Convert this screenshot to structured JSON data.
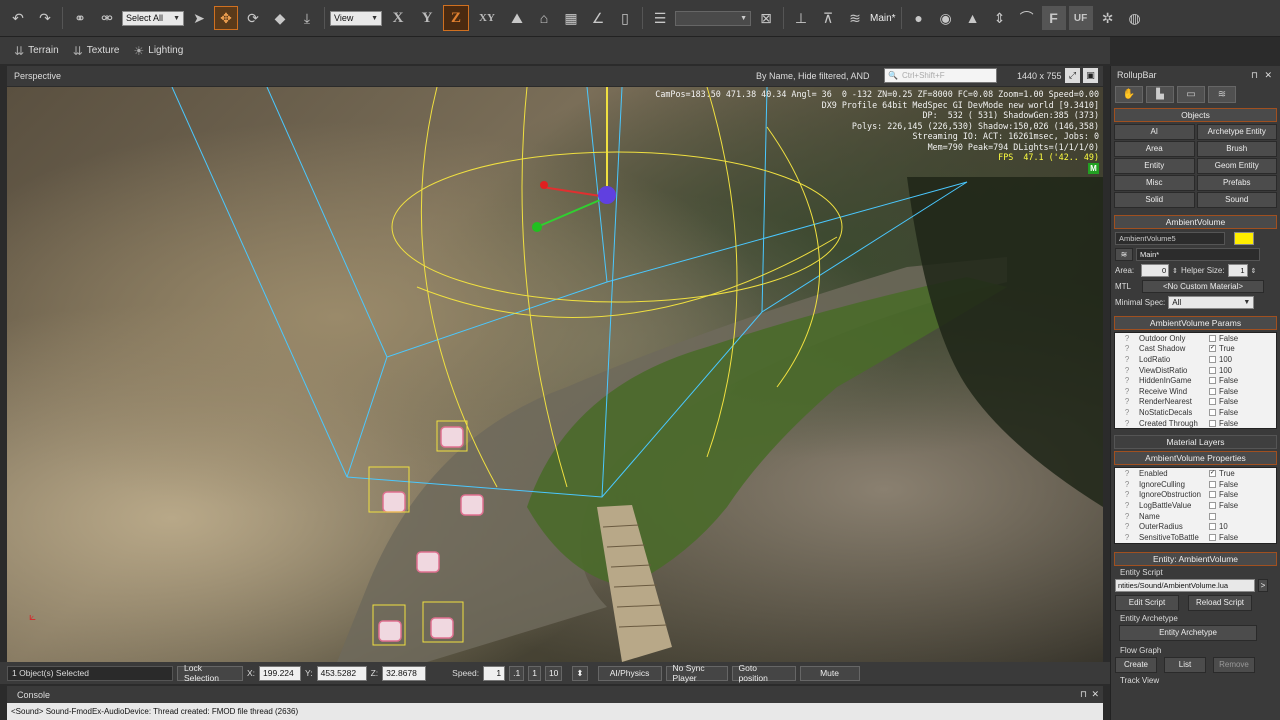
{
  "toolbar": {
    "select_all": "Select All",
    "view": "View",
    "axes": [
      "X",
      "Y",
      "Z",
      "XY"
    ],
    "layer": "Main*",
    "icons": [
      "undo-icon",
      "redo-icon",
      "link-icon",
      "unlink-icon",
      "cursor-icon",
      "move-icon",
      "rotate-icon",
      "scale-icon",
      "snap-icon",
      "grid-icon",
      "angle-icon",
      "ruler-icon"
    ]
  },
  "subbar": {
    "terrain": "Terrain",
    "texture": "Texture",
    "lighting": "Lighting"
  },
  "viewport": {
    "title": "Perspective",
    "filter": "By Name, Hide filtered, AND",
    "search_placeholder": "Ctrl+Shift+F",
    "resolution": "1440 x 755",
    "stats": [
      "CamPos=183.50 471.38 40.34 Angl= 36  0 -132 ZN=0.25 ZF=8000 FC=0.08 Zoom=1.00 Speed=0.00",
      "DX9 Profile 64bit MedSpec GI DevMode new world [9.3410]",
      "DP:  532 ( 531) ShadowGen:385 (373)",
      "Polys: 226,145 (226,530) Shadow:150,026 (146,358)",
      "Streaming IO: ACT: 16261msec, Jobs: 0",
      "Mem=790 Peak=794 DLights=(1/1/1/0)"
    ],
    "fps": "FPS  47.1 ('42.. 49)",
    "m_badge": "M"
  },
  "statusbar": {
    "selected": "1 Object(s) Selected",
    "lock": "Lock Selection",
    "x_label": "X:",
    "x": "199.224",
    "y_label": "Y:",
    "y": "453.5282",
    "z_label": "Z:",
    "z": "32.8678",
    "speed_label": "Speed:",
    "speed": "1",
    "speed_opts": [
      ".1",
      "1",
      "10"
    ],
    "ai_physics": "AI/Physics",
    "no_sync": "No Sync Player",
    "goto": "Goto position",
    "mute": "Mute"
  },
  "console": {
    "title": "Console",
    "line": "<Sound> Sound-FmodEx-AudioDevice: Thread created: FMOD file thread (2636)"
  },
  "rollup": {
    "title": "RollupBar",
    "objects_title": "Objects",
    "object_buttons": [
      "AI",
      "Archetype Entity",
      "Area",
      "Brush",
      "Entity",
      "Geom Entity",
      "Misc",
      "Prefabs",
      "Solid",
      "Sound"
    ],
    "ambient_title": "AmbientVolume",
    "ambient_name": "AmbientVolume5",
    "ambient_color": "#ffee00",
    "layer": "Main*",
    "area_label": "Area:",
    "area_val": "0",
    "helper_label": "Helper Size:",
    "helper_val": "1",
    "mtl_label": "MTL",
    "mtl_val": "<No Custom Material>",
    "minspec_label": "Minimal Spec:",
    "minspec_val": "All",
    "params_title": "AmbientVolume Params",
    "params": [
      {
        "name": "Outdoor Only",
        "chk": "",
        "val": "False"
      },
      {
        "name": "Cast Shadow",
        "chk": "✓",
        "val": "True"
      },
      {
        "name": "LodRatio",
        "chk": "",
        "val": "100"
      },
      {
        "name": "ViewDistRatio",
        "chk": "",
        "val": "100"
      },
      {
        "name": "HiddenInGame",
        "chk": "",
        "val": "False"
      },
      {
        "name": "Receive Wind",
        "chk": "",
        "val": "False"
      },
      {
        "name": "RenderNearest",
        "chk": "",
        "val": "False"
      },
      {
        "name": "NoStaticDecals",
        "chk": "",
        "val": "False"
      },
      {
        "name": "Created Through",
        "chk": "",
        "val": "False"
      }
    ],
    "material_layers": "Material Layers",
    "props_title": "AmbientVolume Properties",
    "props": [
      {
        "name": "Enabled",
        "chk": "✓",
        "val": "True"
      },
      {
        "name": "IgnoreCulling",
        "chk": "",
        "val": "False"
      },
      {
        "name": "IgnoreObstruction",
        "chk": "",
        "val": "False"
      },
      {
        "name": "LogBattleValue",
        "chk": "",
        "val": "False"
      },
      {
        "name": "Name",
        "chk": "",
        "val": ""
      },
      {
        "name": "OuterRadius",
        "chk": "",
        "val": "10"
      },
      {
        "name": "SensitiveToBattle",
        "chk": "",
        "val": "False"
      }
    ],
    "entity_title": "Entity: AmbientVolume",
    "entity_script_label": "Entity Script",
    "entity_script": "ntities/Sound/AmbientVolume.lua",
    "edit_script": "Edit Script",
    "reload_script": "Reload Script",
    "entity_archetype_label": "Entity Archetype",
    "entity_archetype_btn": "Entity Archetype",
    "flow_graph_label": "Flow Graph",
    "create": "Create",
    "list": "List",
    "remove": "Remove",
    "track_view": "Track View"
  }
}
